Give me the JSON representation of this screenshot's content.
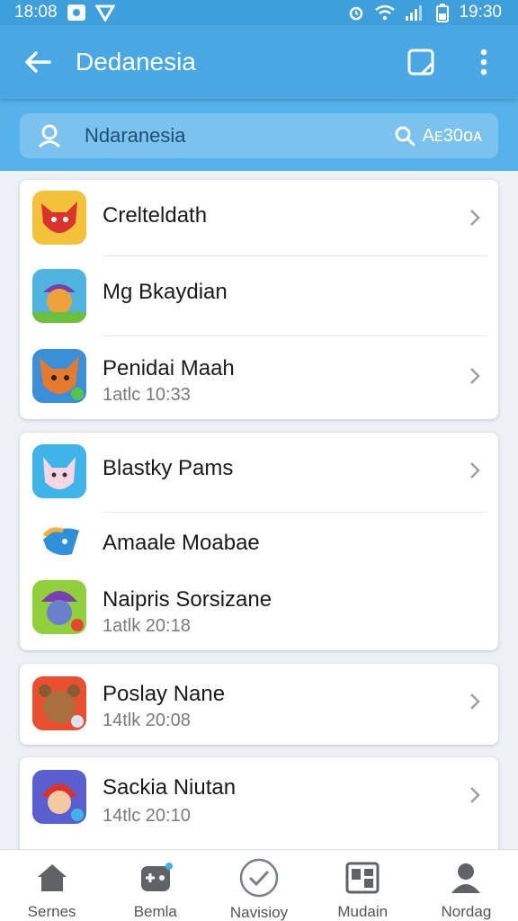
{
  "status_bar": {
    "time_left": "18:08",
    "time_right": "19:30"
  },
  "app_bar": {
    "title": "Dedanesia"
  },
  "search": {
    "placeholder": "Ndaranesia",
    "button_label": "Aᴇ30ᴏᴀ"
  },
  "lists": [
    {
      "items": [
        {
          "name": "Crelteldath",
          "sub": "",
          "avatar": "red-fox-avatar",
          "chevron": true
        },
        {
          "name": "Mg Bkaydian",
          "sub": "",
          "avatar": "purple-hat-cat-avatar",
          "chevron": false
        },
        {
          "name": "Penidai Maah",
          "sub": "1atlc  10:33",
          "avatar": "orange-fox-avatar",
          "chevron": true
        }
      ]
    },
    {
      "items": [
        {
          "name": "Blastky Pams",
          "sub": "",
          "avatar": "pink-cat-avatar",
          "chevron": true
        },
        {
          "name": "Amaale Moabae",
          "sub": "",
          "avatar": "blue-bird-avatar",
          "chevron": false
        },
        {
          "name": "Naipris Sorsizane",
          "sub": "1atlk  20:18",
          "avatar": "purple-witch-avatar",
          "chevron": false
        }
      ]
    },
    {
      "items": [
        {
          "name": "Poslay Nane",
          "sub": "14tlk  20:08",
          "avatar": "brown-bear-avatar",
          "chevron": true
        }
      ]
    },
    {
      "items": [
        {
          "name": "Sackia Niutan",
          "sub": "14tlc  20:10",
          "avatar": "red-hair-girl-avatar",
          "chevron": true
        }
      ]
    }
  ],
  "bottom_nav": [
    {
      "label": "Sernes",
      "icon": "home-icon"
    },
    {
      "label": "Bemla",
      "icon": "game-controller-icon"
    },
    {
      "label": "Navisioy",
      "icon": "check-circle-icon"
    },
    {
      "label": "Mudain",
      "icon": "gallery-icon"
    },
    {
      "label": "Nordag",
      "icon": "person-icon"
    }
  ],
  "colors": {
    "status_bar": "#3f9fdc",
    "app_bar": "#49a8e4",
    "search_band": "#56b2ea",
    "search_box": "#7cc2ee"
  }
}
